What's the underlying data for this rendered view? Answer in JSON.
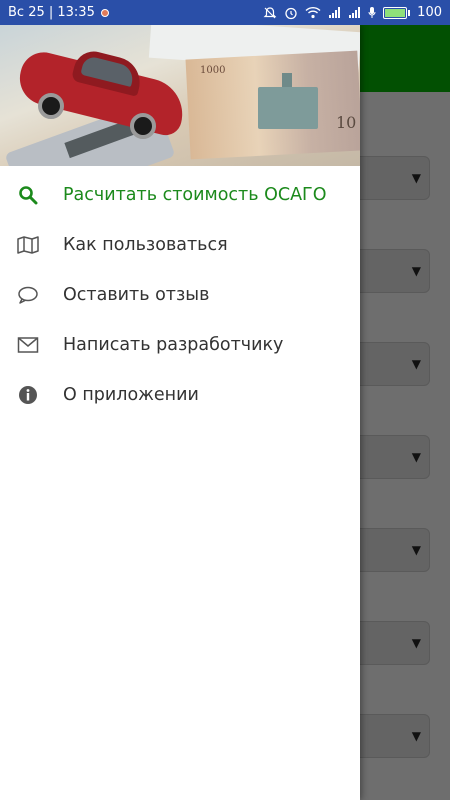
{
  "status_bar": {
    "time_text": "Вс 25 | 13:35",
    "battery_level": "100",
    "icons": [
      "mute-icon",
      "alarm-icon",
      "wifi-icon",
      "signal-icon",
      "signal-icon",
      "mic-icon",
      "battery-icon"
    ]
  },
  "colors": {
    "status_bar": "#2a4fa8",
    "app_bar": "#025002",
    "active_item": "#1c8a1c",
    "drawer_bg": "#ffffff"
  },
  "drawer": {
    "header_image": "car-and-money-illustration",
    "header_note_denomination": "1000",
    "header_note_denomination_right": "10",
    "items": [
      {
        "label": "Расчитать стоимость ОСАГО",
        "icon": "search-icon",
        "active": true
      },
      {
        "label": "Как пользоваться",
        "icon": "map-icon",
        "active": false
      },
      {
        "label": "Оставить отзыв",
        "icon": "chat-bubble-icon",
        "active": false
      },
      {
        "label": "Написать разработчику",
        "icon": "mail-icon",
        "active": false
      },
      {
        "label": "О приложении",
        "icon": "info-icon",
        "active": false
      }
    ]
  },
  "background_form": {
    "dropdown_count": 7
  }
}
